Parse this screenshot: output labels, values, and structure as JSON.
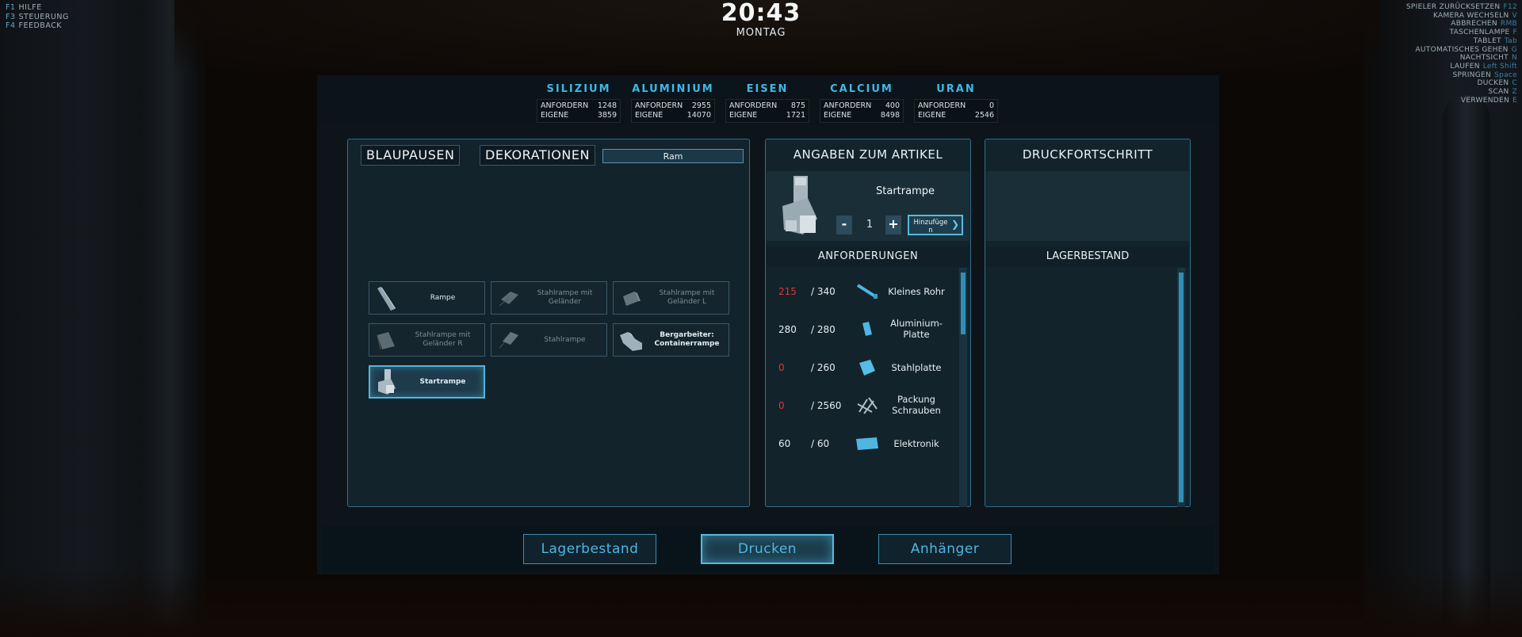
{
  "hud": {
    "left": [
      {
        "key": "F1",
        "label": "HILFE"
      },
      {
        "key": "F3",
        "label": "STEUERUNG"
      },
      {
        "key": "F4",
        "label": "FEEDBACK"
      }
    ],
    "right": [
      {
        "label": "SPIELER ZURÜCKSETZEN",
        "key": "F12"
      },
      {
        "label": "KAMERA WECHSELN",
        "key": "V"
      },
      {
        "label": "ABBRECHEN",
        "key": "RMB"
      },
      {
        "label": "TASCHENLAMPE",
        "key": "F"
      },
      {
        "label": "TABLET",
        "key": "Tab"
      },
      {
        "label": "AUTOMATISCHES GEHEN",
        "key": "G"
      },
      {
        "label": "NACHTSICHT",
        "key": "N"
      },
      {
        "label": "LAUFEN",
        "key": "Left Shift"
      },
      {
        "label": "SPRINGEN",
        "key": "Space"
      },
      {
        "label": "DUCKEN",
        "key": "C"
      },
      {
        "label": "SCAN",
        "key": "Z"
      },
      {
        "label": "VERWENDEN",
        "key": "E"
      }
    ],
    "time": "20:43",
    "day": "MONTAG"
  },
  "resources": [
    {
      "name": "SILIZIUM",
      "req_label": "ANFORDERN",
      "req": "1248",
      "own_label": "EIGENE",
      "own": "3859"
    },
    {
      "name": "ALUMINIUM",
      "req_label": "ANFORDERN",
      "req": "2955",
      "own_label": "EIGENE",
      "own": "14070"
    },
    {
      "name": "EISEN",
      "req_label": "ANFORDERN",
      "req": "875",
      "own_label": "EIGENE",
      "own": "1721"
    },
    {
      "name": "CALCIUM",
      "req_label": "ANFORDERN",
      "req": "400",
      "own_label": "EIGENE",
      "own": "8498"
    },
    {
      "name": "URAN",
      "req_label": "ANFORDERN",
      "req": "0",
      "own_label": "EIGENE",
      "own": "2546"
    }
  ],
  "left_panel": {
    "tab_blueprints": "BLAUPAUSEN",
    "tab_decorations": "DEKORATIONEN",
    "search_value": "Ram",
    "blueprints": [
      {
        "label": "Rampe",
        "icon": "ramp-icon",
        "available": true
      },
      {
        "label": "Stahlrampe mit Geländer",
        "icon": "steel-ramp-railing-icon",
        "available": false
      },
      {
        "label": "Stahlrampe mit Geländer L",
        "icon": "steel-ramp-railing-left-icon",
        "available": false
      },
      {
        "label": "Stahlrampe mit Geländer R",
        "icon": "steel-ramp-railing-right-icon",
        "available": false
      },
      {
        "label": "Stahlrampe",
        "icon": "steel-ramp-icon",
        "available": false
      },
      {
        "label": "Bergarbeiter: Containerrampe",
        "icon": "container-ramp-icon",
        "available": true
      },
      {
        "label": "Startrampe",
        "icon": "launch-ramp-icon",
        "available": true,
        "selected": true
      }
    ]
  },
  "details": {
    "title": "ANGABEN ZUM ARTIKEL",
    "item_name": "Startrampe",
    "quantity": "1",
    "minus": "-",
    "plus": "+",
    "add_label": "Hinzufüge n",
    "requirements_title": "ANFORDERUNGEN",
    "requirements": [
      {
        "have": "215",
        "need": "/ 340",
        "name": "Kleines Rohr",
        "icon": "small-pipe-icon",
        "have_color": "#e3342c"
      },
      {
        "have": "280",
        "need": "/ 280",
        "name": "Aluminium-Platte",
        "icon": "aluminium-plate-icon",
        "have_color": "#e6eef2"
      },
      {
        "have": "0",
        "need": "/ 260",
        "name": "Stahlplatte",
        "icon": "steel-plate-icon",
        "have_color": "#e3342c"
      },
      {
        "have": "0",
        "need": "/ 2560",
        "name": "Packung Schrauben",
        "icon": "screws-pack-icon",
        "have_color": "#e3342c"
      },
      {
        "have": "60",
        "need": "/ 60",
        "name": "Elektronik",
        "icon": "electronics-icon",
        "have_color": "#e6eef2"
      }
    ]
  },
  "progress": {
    "title": "DRUCKFORTSCHRITT",
    "storage_title": "LAGERBESTAND"
  },
  "buttons": {
    "storage": "Lagerbestand",
    "print": "Drucken",
    "trailer": "Anhänger"
  },
  "colors": {
    "accent": "#3fb7e6",
    "warning": "#e3342c",
    "panel": "#13232c"
  }
}
